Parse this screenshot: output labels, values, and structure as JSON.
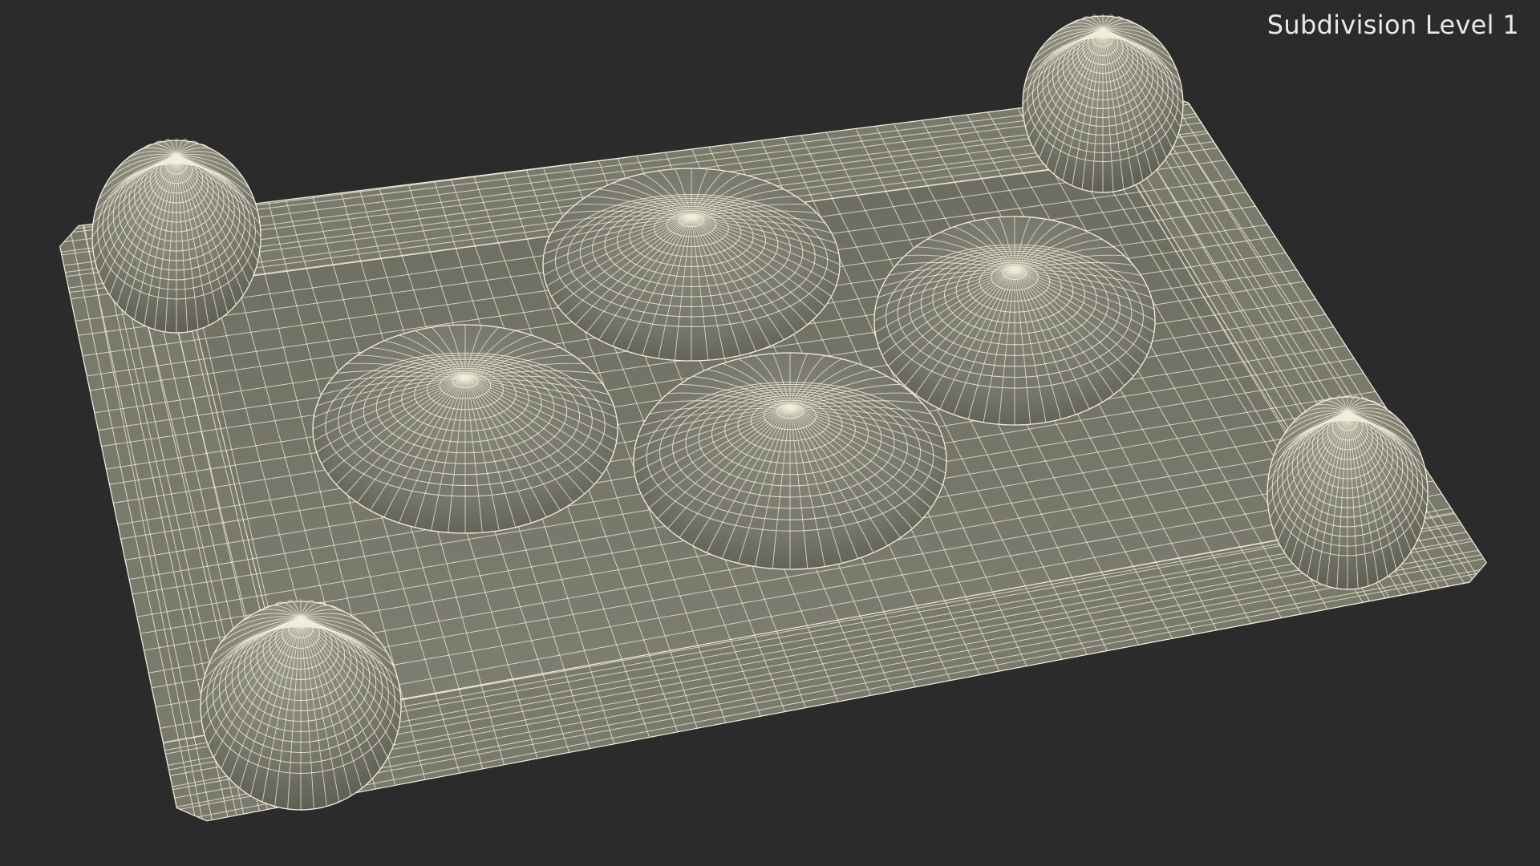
{
  "overlay": {
    "subdivision_label": "Subdivision Level 1"
  },
  "colors": {
    "background": "#2b2b2b",
    "surface": "#7a7a6c",
    "surface_dark": "#5e5e52",
    "surface_light": "#8e8e80",
    "wire": "#f2efdc"
  },
  "model": {
    "name": "wireframe-tray",
    "render_mode": "wireframe-on-shaded",
    "features": [
      "tray-base",
      "corner-post",
      "corner-post",
      "corner-post",
      "corner-post",
      "oval-bump",
      "oval-bump",
      "oval-bump",
      "oval-bump"
    ]
  }
}
